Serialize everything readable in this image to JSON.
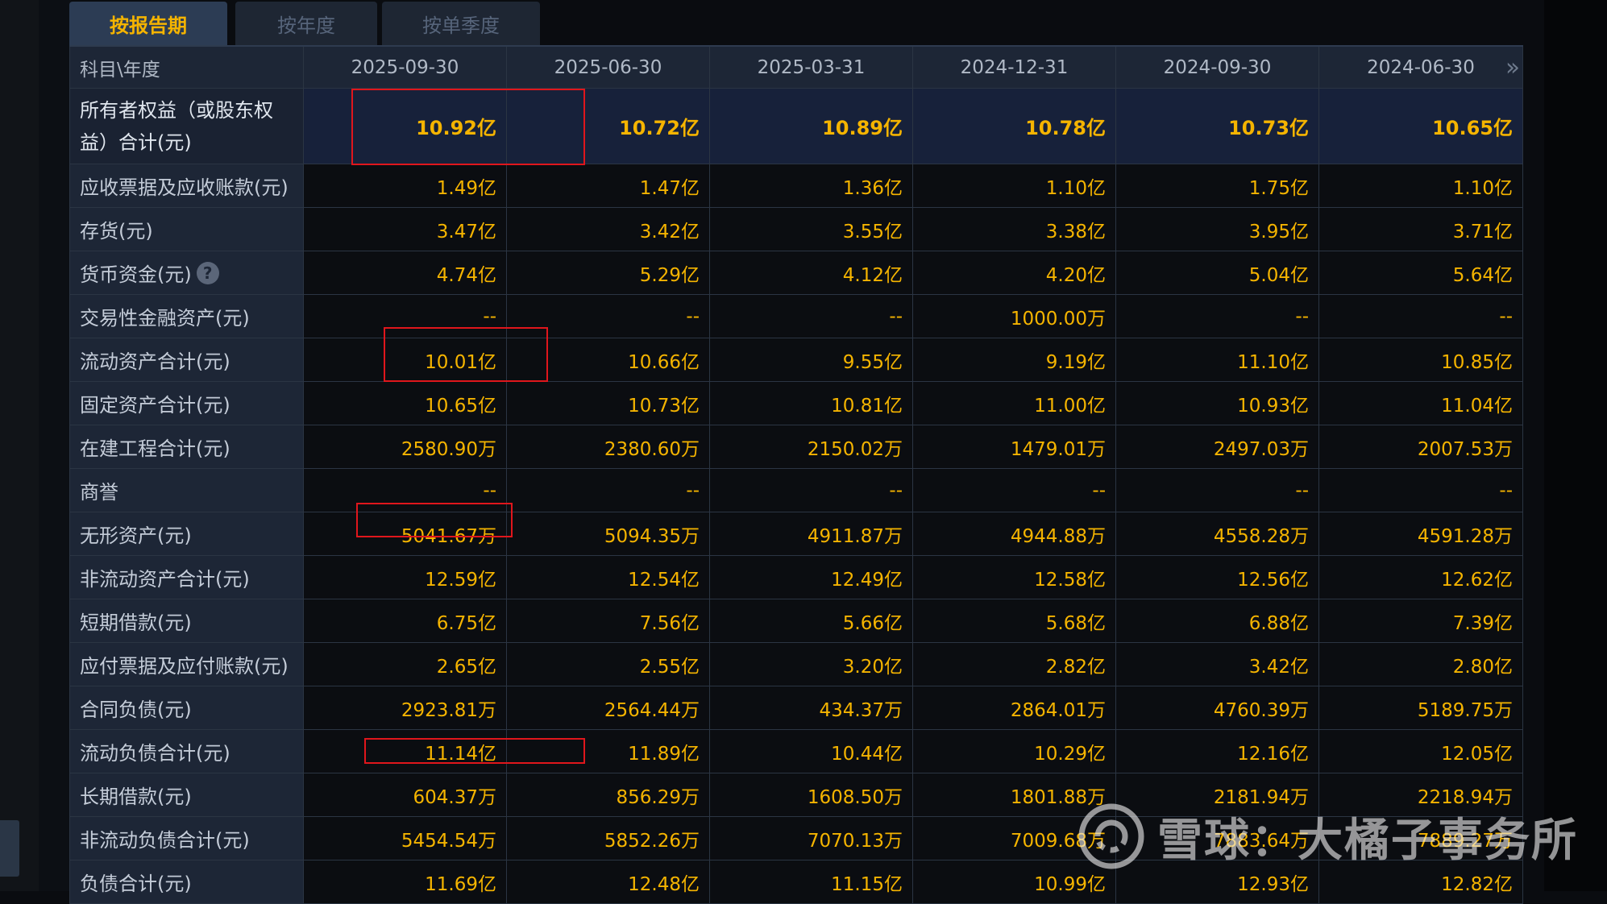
{
  "tabs": [
    {
      "label": "按报告期",
      "active": true
    },
    {
      "label": "按年度",
      "active": false
    },
    {
      "label": "按单季度",
      "active": false
    }
  ],
  "table": {
    "header_label": "科目\\年度",
    "columns": [
      "2025-09-30",
      "2025-06-30",
      "2025-03-31",
      "2024-12-31",
      "2024-09-30",
      "2024-06-30"
    ],
    "rows": [
      {
        "label_line1": "所有者权益（或股东权",
        "label_line2": "益）合计(元)",
        "values": [
          "10.92亿",
          "10.72亿",
          "10.89亿",
          "10.78亿",
          "10.73亿",
          "10.65亿"
        ]
      },
      {
        "label": "应收票据及应收账款(元)",
        "values": [
          "1.49亿",
          "1.47亿",
          "1.36亿",
          "1.10亿",
          "1.75亿",
          "1.10亿"
        ]
      },
      {
        "label": "存货(元)",
        "values": [
          "3.47亿",
          "3.42亿",
          "3.55亿",
          "3.38亿",
          "3.95亿",
          "3.71亿"
        ]
      },
      {
        "label": "货币资金(元)",
        "help_icon": "question-circle-icon",
        "values": [
          "4.74亿",
          "5.29亿",
          "4.12亿",
          "4.20亿",
          "5.04亿",
          "5.64亿"
        ]
      },
      {
        "label": "交易性金融资产(元)",
        "values": [
          "--",
          "--",
          "--",
          "1000.00万",
          "--",
          "--"
        ]
      },
      {
        "label": "流动资产合计(元)",
        "values": [
          "10.01亿",
          "10.66亿",
          "9.55亿",
          "9.19亿",
          "11.10亿",
          "10.85亿"
        ]
      },
      {
        "label": "固定资产合计(元)",
        "values": [
          "10.65亿",
          "10.73亿",
          "10.81亿",
          "11.00亿",
          "10.93亿",
          "11.04亿"
        ]
      },
      {
        "label": "在建工程合计(元)",
        "values": [
          "2580.90万",
          "2380.60万",
          "2150.02万",
          "1479.01万",
          "2497.03万",
          "2007.53万"
        ]
      },
      {
        "label": "商誉",
        "values": [
          "--",
          "--",
          "--",
          "--",
          "--",
          "--"
        ]
      },
      {
        "label": "无形资产(元)",
        "values": [
          "5041.67万",
          "5094.35万",
          "4911.87万",
          "4944.88万",
          "4558.28万",
          "4591.28万"
        ]
      },
      {
        "label": "非流动资产合计(元)",
        "values": [
          "12.59亿",
          "12.54亿",
          "12.49亿",
          "12.58亿",
          "12.56亿",
          "12.62亿"
        ]
      },
      {
        "label": "短期借款(元)",
        "values": [
          "6.75亿",
          "7.56亿",
          "5.66亿",
          "5.68亿",
          "6.88亿",
          "7.39亿"
        ]
      },
      {
        "label": "应付票据及应付账款(元)",
        "values": [
          "2.65亿",
          "2.55亿",
          "3.20亿",
          "2.82亿",
          "3.42亿",
          "2.80亿"
        ]
      },
      {
        "label": "合同负债(元)",
        "values": [
          "2923.81万",
          "2564.44万",
          "434.37万",
          "2864.01万",
          "4760.39万",
          "5189.75万"
        ]
      },
      {
        "label": "流动负债合计(元)",
        "values": [
          "11.14亿",
          "11.89亿",
          "10.44亿",
          "10.29亿",
          "12.16亿",
          "12.05亿"
        ]
      },
      {
        "label": "长期借款(元)",
        "values": [
          "604.37万",
          "856.29万",
          "1608.50万",
          "1801.88万",
          "2181.94万",
          "2218.94万"
        ]
      },
      {
        "label": "非流动负债合计(元)",
        "values": [
          "5454.54万",
          "5852.26万",
          "7070.13万",
          "7009.68万",
          "7883.64万",
          "7889.27万"
        ]
      },
      {
        "label": "负债合计(元)",
        "values": [
          "11.69亿",
          "12.48亿",
          "11.15亿",
          "10.99亿",
          "12.93亿",
          "12.82亿"
        ]
      }
    ]
  },
  "more_columns_icon": "double-chevron-right-icon",
  "watermark": {
    "text": "雪球：大橘子事务所",
    "logo": "xueqiu-logo-icon"
  },
  "colors": {
    "value": "#f5b400",
    "tab_active_text": "#f5b400",
    "highlight_box": "#e0161c"
  }
}
